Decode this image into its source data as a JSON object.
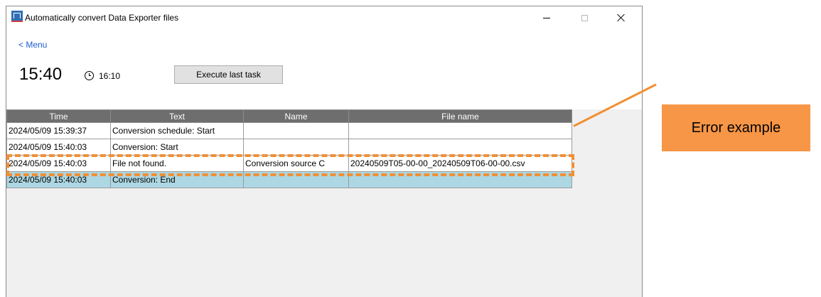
{
  "window": {
    "title": "Automatically convert Data Exporter files",
    "app_icon": "app-icon"
  },
  "nav": {
    "menu_link": "< Menu"
  },
  "clock": {
    "current_time": "15:40",
    "scheduled_time": "16:10",
    "schedule_icon": "alarm-clock-icon"
  },
  "toolbar": {
    "execute_last_task": "Execute last task"
  },
  "log_table": {
    "columns": [
      "Time",
      "Text",
      "Name",
      "File name"
    ],
    "rows": [
      {
        "time": "2024/05/09 15:39:37",
        "text": "Conversion schedule: Start",
        "name": "",
        "file_name": ""
      },
      {
        "time": "2024/05/09 15:40:03",
        "text": "Conversion: Start",
        "name": "",
        "file_name": ""
      },
      {
        "time": "2024/05/09 15:40:03",
        "text": "File not found.",
        "name": "Conversion source C",
        "file_name": "20240509T05-00-00_20240509T06-00-00.csv"
      },
      {
        "time": "2024/05/09 15:40:03",
        "text": "Conversion: End",
        "name": "",
        "file_name": ""
      }
    ],
    "selected_row_index": 3
  },
  "annotation": {
    "label": "Error example",
    "color": "#f79646",
    "highlight_color": "#f28f34"
  },
  "colors": {
    "header_bg": "#6e6e6e",
    "selected_row": "#acd7e3",
    "link": "#1a5fd0"
  }
}
